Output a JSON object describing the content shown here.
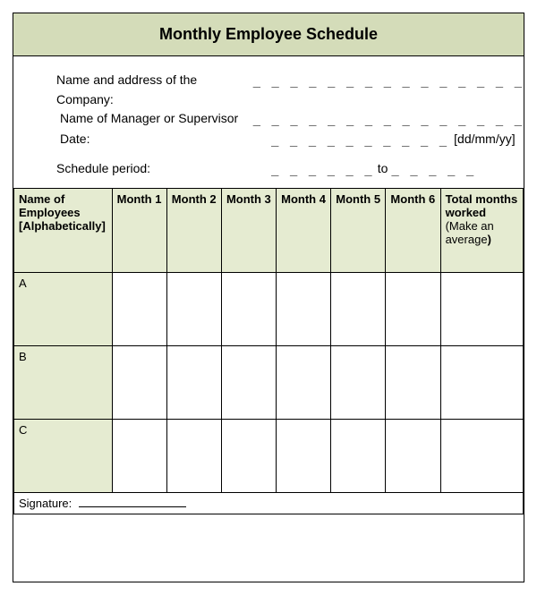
{
  "title": "Monthly Employee Schedule",
  "info": {
    "company_label": "Name and address of the Company:",
    "company_blanks": "_ _ _ _ _ _ _ _ _ _ _ _ _ _ _",
    "manager_label": "Name of Manager or Supervisor",
    "manager_blanks": "_ _ _ _ _ _ _ _ _ _ _ _ _ _ _",
    "date_label": "Date:",
    "date_blanks": "_ _ _ _ _ _ _ _ _ _",
    "date_hint": "[dd/mm/yy]",
    "period_label": "Schedule period:",
    "period_from_blanks": "_ _ _ _ _ _",
    "period_to_label": "to",
    "period_to_blanks": "_ _ _ _ _"
  },
  "headers": {
    "name": "Name of Employees [Alphabetically]",
    "m1": "Month 1",
    "m2": "Month 2",
    "m3": "Month 3",
    "m4": "Month 4",
    "m5": "Month 5",
    "m6": "Month 6",
    "total_line1": "Total months worked",
    "total_sub_prefix": "(Make an average",
    "total_sub_paren": ")"
  },
  "rows": {
    "r0": {
      "name": "A"
    },
    "r1": {
      "name": "B"
    },
    "r2": {
      "name": "C"
    }
  },
  "signature_label": "Signature:"
}
